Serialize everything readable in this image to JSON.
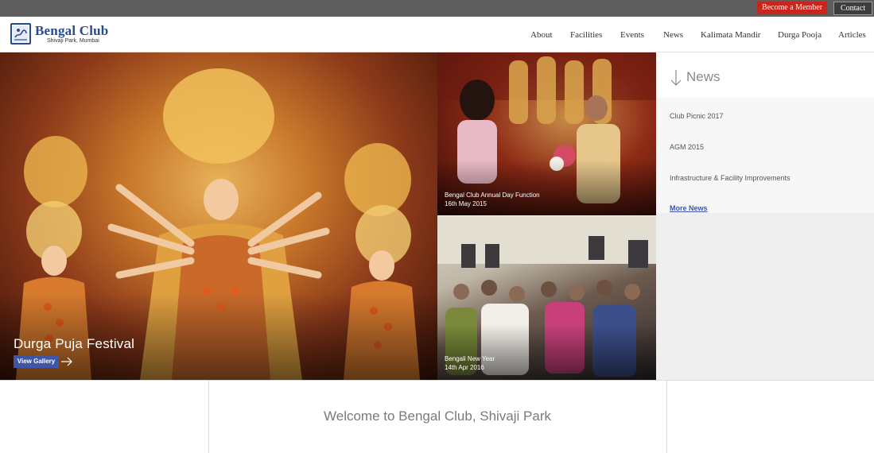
{
  "topbar": {
    "member_label": "Become a Member",
    "contact_label": "Contact"
  },
  "header": {
    "logo_name": "Bengal Club",
    "logo_subtitle": "Shivaji Park, Mumbai",
    "nav": [
      "About",
      "Facilities",
      "Events",
      "News",
      "Kalimata Mandir",
      "Durga Pooja",
      "Articles"
    ]
  },
  "hero": {
    "title": "Durga Puja Festival",
    "gallery_label": "View Gallery"
  },
  "tiles": [
    {
      "line1": "Bengal Club Annual Day Function",
      "line2": "16th May 2015"
    },
    {
      "line1": "Bengali New Year",
      "line2": "14th Apr 2016"
    }
  ],
  "news": {
    "title": "News",
    "items": [
      "Club Picnic 2017",
      "AGM 2015",
      "Infrastructure & Facility Improvements"
    ],
    "more_label": "More News"
  },
  "welcome": {
    "text": "Welcome to Bengal Club, Shivaji Park"
  },
  "colors": {
    "accent_red": "#c8261d",
    "brand_blue": "#2b4a8c",
    "button_blue": "#3f55a8"
  }
}
